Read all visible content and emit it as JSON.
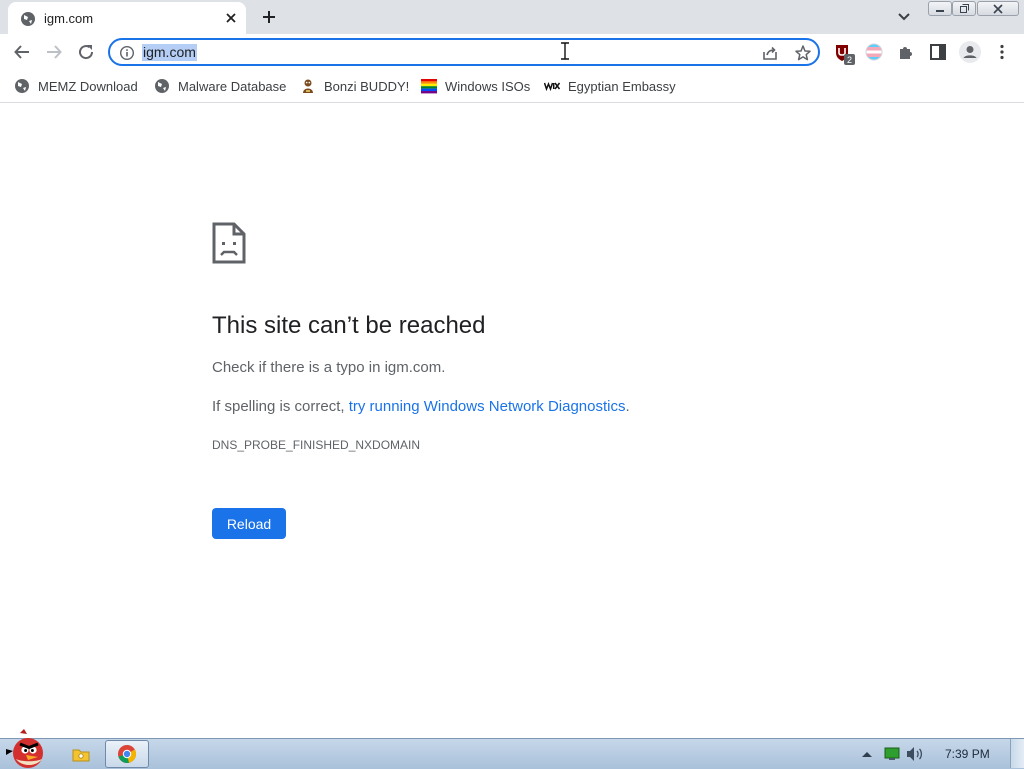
{
  "tab": {
    "title": "igm.com",
    "favicon": "globe-icon"
  },
  "omnibox": {
    "url": "igm.com"
  },
  "bookmarks": [
    {
      "label": "MEMZ Download",
      "icon": "globe-icon"
    },
    {
      "label": "Malware Database",
      "icon": "globe-icon"
    },
    {
      "label": "Bonzi BUDDY!",
      "icon": "bonzi-icon"
    },
    {
      "label": "Windows ISOs",
      "icon": "rainbow-flag-icon"
    },
    {
      "label": "Egyptian Embassy",
      "icon": "wix-icon"
    }
  ],
  "extensions": {
    "ublock_badge": "2"
  },
  "error": {
    "title": "This site can’t be reached",
    "line1": "Check if there is a typo in igm.com.",
    "line2_prefix": "If spelling is correct, ",
    "line2_link": "try running Windows Network Diagnostics",
    "line2_suffix": ".",
    "code": "DNS_PROBE_FINISHED_NXDOMAIN",
    "reload_label": "Reload"
  },
  "taskbar": {
    "clock": "7:39 PM"
  },
  "colors": {
    "accent": "#1a73e8",
    "url_selection": "#b4cef5",
    "tabstrip": "#dee1e6"
  }
}
